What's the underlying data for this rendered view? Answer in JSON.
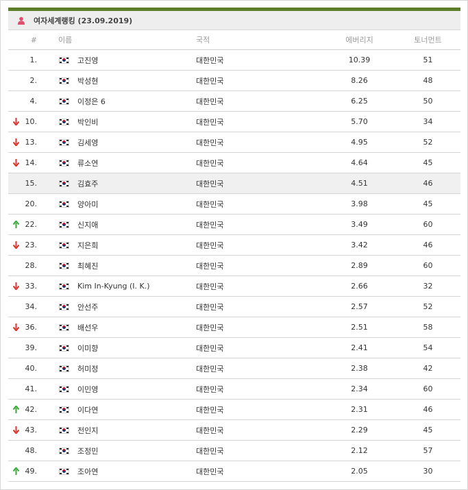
{
  "title": "여자세계랭킹 (23.09.2019)",
  "colors": {
    "topbar": "#5c7d2a",
    "icon": "#e0506e",
    "down": "#d9302a",
    "up": "#3aa73a"
  },
  "headers": {
    "rank": "#",
    "name": "이름",
    "country": "국적",
    "average": "에버리지",
    "tournaments": "토너먼트"
  },
  "rows": [
    {
      "trend": "",
      "rank": "1.",
      "flag": "south-korea-flag",
      "name": "고진영",
      "country": "대한민국",
      "average": "10.39",
      "tournaments": "51"
    },
    {
      "trend": "",
      "rank": "2.",
      "flag": "south-korea-flag",
      "name": "박성현",
      "country": "대한민국",
      "average": "8.26",
      "tournaments": "48"
    },
    {
      "trend": "",
      "rank": "4.",
      "flag": "south-korea-flag",
      "name": "이정은 6",
      "country": "대한민국",
      "average": "6.25",
      "tournaments": "50"
    },
    {
      "trend": "down",
      "rank": "10.",
      "flag": "south-korea-flag",
      "name": "박인비",
      "country": "대한민국",
      "average": "5.70",
      "tournaments": "34"
    },
    {
      "trend": "down",
      "rank": "13.",
      "flag": "south-korea-flag",
      "name": "김세영",
      "country": "대한민국",
      "average": "4.95",
      "tournaments": "52"
    },
    {
      "trend": "down",
      "rank": "14.",
      "flag": "south-korea-flag",
      "name": "류소연",
      "country": "대한민국",
      "average": "4.64",
      "tournaments": "45"
    },
    {
      "trend": "",
      "rank": "15.",
      "flag": "south-korea-flag",
      "name": "김효주",
      "country": "대한민국",
      "average": "4.51",
      "tournaments": "46",
      "highlight": true
    },
    {
      "trend": "",
      "rank": "20.",
      "flag": "south-korea-flag",
      "name": "양아미",
      "country": "대한민국",
      "average": "3.98",
      "tournaments": "45"
    },
    {
      "trend": "up",
      "rank": "22.",
      "flag": "south-korea-flag",
      "name": "신지애",
      "country": "대한민국",
      "average": "3.49",
      "tournaments": "60"
    },
    {
      "trend": "down",
      "rank": "23.",
      "flag": "south-korea-flag",
      "name": "지은희",
      "country": "대한민국",
      "average": "3.42",
      "tournaments": "46"
    },
    {
      "trend": "",
      "rank": "28.",
      "flag": "south-korea-flag",
      "name": "최혜진",
      "country": "대한민국",
      "average": "2.89",
      "tournaments": "60"
    },
    {
      "trend": "down",
      "rank": "33.",
      "flag": "south-korea-flag",
      "name": "Kim In-Kyung (I. K.)",
      "country": "대한민국",
      "average": "2.66",
      "tournaments": "32"
    },
    {
      "trend": "",
      "rank": "34.",
      "flag": "south-korea-flag",
      "name": "안선주",
      "country": "대한민국",
      "average": "2.57",
      "tournaments": "52"
    },
    {
      "trend": "down",
      "rank": "36.",
      "flag": "south-korea-flag",
      "name": "배선우",
      "country": "대한민국",
      "average": "2.51",
      "tournaments": "58"
    },
    {
      "trend": "",
      "rank": "39.",
      "flag": "south-korea-flag",
      "name": "이미향",
      "country": "대한민국",
      "average": "2.41",
      "tournaments": "54"
    },
    {
      "trend": "",
      "rank": "40.",
      "flag": "south-korea-flag",
      "name": "허미정",
      "country": "대한민국",
      "average": "2.38",
      "tournaments": "42"
    },
    {
      "trend": "",
      "rank": "41.",
      "flag": "south-korea-flag",
      "name": "이민영",
      "country": "대한민국",
      "average": "2.34",
      "tournaments": "60"
    },
    {
      "trend": "up",
      "rank": "42.",
      "flag": "south-korea-flag",
      "name": "이다연",
      "country": "대한민국",
      "average": "2.31",
      "tournaments": "46"
    },
    {
      "trend": "down",
      "rank": "43.",
      "flag": "south-korea-flag",
      "name": "전인지",
      "country": "대한민국",
      "average": "2.29",
      "tournaments": "45"
    },
    {
      "trend": "",
      "rank": "48.",
      "flag": "south-korea-flag",
      "name": "조정민",
      "country": "대한민국",
      "average": "2.12",
      "tournaments": "57"
    },
    {
      "trend": "up",
      "rank": "49.",
      "flag": "south-korea-flag",
      "name": "조아연",
      "country": "대한민국",
      "average": "2.05",
      "tournaments": "30"
    }
  ]
}
